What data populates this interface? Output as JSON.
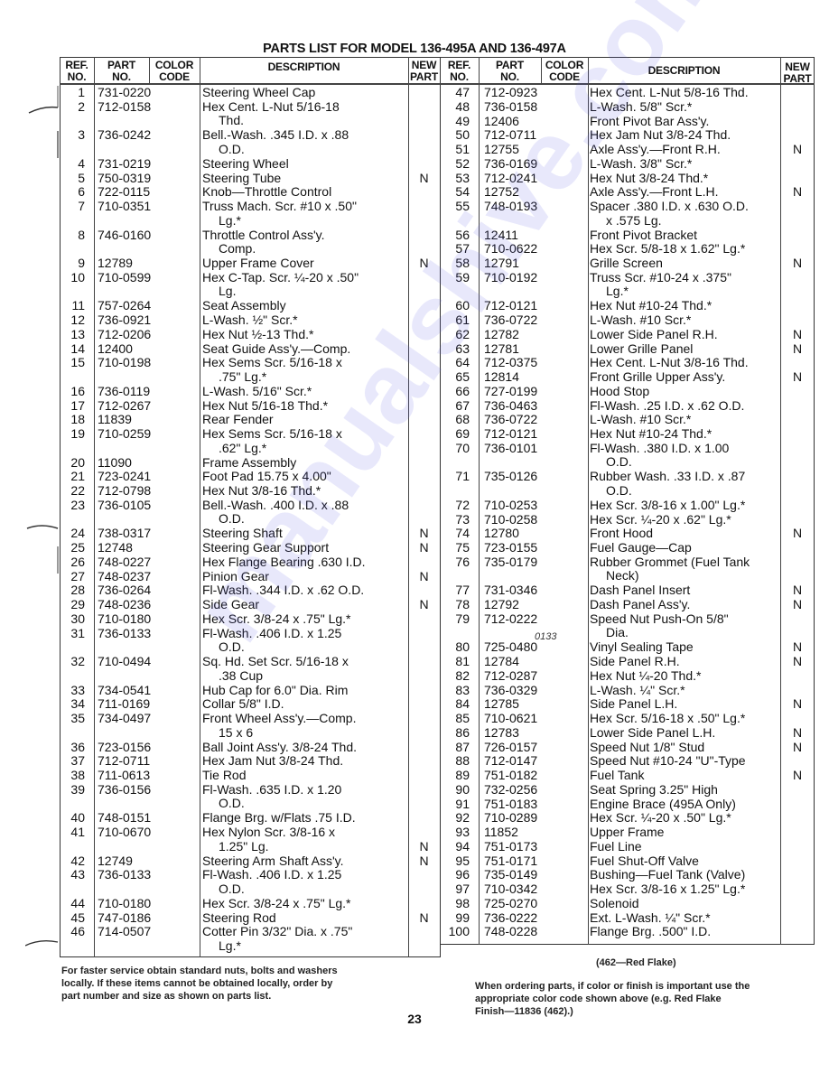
{
  "title": "PARTS LIST FOR MODEL 136-495A AND 136-497A",
  "headers": {
    "ref": [
      "REF.",
      "NO."
    ],
    "part": [
      "PART",
      "NO."
    ],
    "color": [
      "COLOR",
      "CODE"
    ],
    "description": "DESCRIPTION",
    "new": [
      "NEW",
      "PART"
    ]
  },
  "left_rows": [
    {
      "ref": "1",
      "part": "731-0220",
      "desc": [
        "Steering Wheel Cap"
      ],
      "new": ""
    },
    {
      "ref": "2",
      "part": "712-0158",
      "desc": [
        "Hex Cent. L-Nut 5/16-18",
        "Thd."
      ],
      "new": ""
    },
    {
      "ref": "3",
      "part": "736-0242",
      "desc": [
        "Bell.-Wash. .345 I.D. x .88",
        "O.D."
      ],
      "new": ""
    },
    {
      "ref": "4",
      "part": "731-0219",
      "desc": [
        "Steering Wheel"
      ],
      "new": ""
    },
    {
      "ref": "5",
      "part": "750-0319",
      "desc": [
        "Steering Tube"
      ],
      "new": "N"
    },
    {
      "ref": "6",
      "part": "722-0115",
      "desc": [
        "Knob—Throttle Control"
      ],
      "new": ""
    },
    {
      "ref": "7",
      "part": "710-0351",
      "desc": [
        "Truss Mach. Scr. #10 x .50\"",
        "Lg.*"
      ],
      "new": ""
    },
    {
      "ref": "8",
      "part": "746-0160",
      "desc": [
        "Throttle Control Ass'y.",
        "Comp."
      ],
      "new": ""
    },
    {
      "ref": "9",
      "part": "12789",
      "desc": [
        "Upper Frame Cover"
      ],
      "new": "N"
    },
    {
      "ref": "10",
      "part": "710-0599",
      "desc": [
        "Hex C-Tap. Scr. ¼-20 x .50\"",
        "Lg."
      ],
      "new": ""
    },
    {
      "ref": "11",
      "part": "757-0264",
      "desc": [
        "Seat Assembly"
      ],
      "new": ""
    },
    {
      "ref": "12",
      "part": "736-0921",
      "desc": [
        "L-Wash. ½\" Scr.*"
      ],
      "new": ""
    },
    {
      "ref": "13",
      "part": "712-0206",
      "desc": [
        "Hex Nut ½-13 Thd.*"
      ],
      "new": ""
    },
    {
      "ref": "14",
      "part": "12400",
      "desc": [
        "Seat Guide Ass'y.—Comp."
      ],
      "new": ""
    },
    {
      "ref": "15",
      "part": "710-0198",
      "desc": [
        "Hex Sems Scr. 5/16-18 x",
        ".75\" Lg.*"
      ],
      "new": ""
    },
    {
      "ref": "16",
      "part": "736-0119",
      "desc": [
        "L-Wash. 5/16\" Scr.*"
      ],
      "new": ""
    },
    {
      "ref": "17",
      "part": "712-0267",
      "desc": [
        "Hex Nut 5/16-18 Thd.*"
      ],
      "new": ""
    },
    {
      "ref": "18",
      "part": "11839",
      "desc": [
        "Rear Fender"
      ],
      "new": ""
    },
    {
      "ref": "19",
      "part": "710-0259",
      "desc": [
        "Hex Sems Scr. 5/16-18 x",
        ".62\" Lg.*"
      ],
      "new": ""
    },
    {
      "ref": "20",
      "part": "11090",
      "desc": [
        "Frame Assembly"
      ],
      "new": ""
    },
    {
      "ref": "21",
      "part": "723-0241",
      "desc": [
        "Foot Pad 15.75 x 4.00\""
      ],
      "new": ""
    },
    {
      "ref": "22",
      "part": "712-0798",
      "desc": [
        "Hex Nut 3/8-16 Thd.*"
      ],
      "new": ""
    },
    {
      "ref": "23",
      "part": "736-0105",
      "desc": [
        "Bell.-Wash. .400 I.D. x .88",
        "O.D."
      ],
      "new": ""
    },
    {
      "ref": "24",
      "part": "738-0317",
      "desc": [
        "Steering Shaft"
      ],
      "new": "N"
    },
    {
      "ref": "25",
      "part": "12748",
      "desc": [
        "Steering Gear Support"
      ],
      "new": "N"
    },
    {
      "ref": "26",
      "part": "748-0227",
      "desc": [
        "Hex Flange Bearing .630 I.D."
      ],
      "new": ""
    },
    {
      "ref": "27",
      "part": "748-0237",
      "desc": [
        "Pinion Gear"
      ],
      "new": "N"
    },
    {
      "ref": "28",
      "part": "736-0264",
      "desc": [
        "Fl-Wash. .344 I.D. x .62 O.D."
      ],
      "new": ""
    },
    {
      "ref": "29",
      "part": "748-0236",
      "desc": [
        "Side Gear"
      ],
      "new": "N"
    },
    {
      "ref": "30",
      "part": "710-0180",
      "desc": [
        "Hex Scr. 3/8-24 x .75\" Lg.*"
      ],
      "new": ""
    },
    {
      "ref": "31",
      "part": "736-0133",
      "desc": [
        "Fl-Wash. .406 I.D. x 1.25",
        "O.D."
      ],
      "new": ""
    },
    {
      "ref": "32",
      "part": "710-0494",
      "desc": [
        "Sq. Hd. Set Scr. 5/16-18 x",
        ".38 Cup"
      ],
      "new": ""
    },
    {
      "ref": "33",
      "part": "734-0541",
      "desc": [
        "Hub Cap for 6.0\" Dia. Rim"
      ],
      "new": ""
    },
    {
      "ref": "34",
      "part": "711-0169",
      "desc": [
        "Collar 5/8\" I.D."
      ],
      "new": ""
    },
    {
      "ref": "35",
      "part": "734-0497",
      "desc": [
        "Front Wheel Ass'y.—Comp.",
        "15 x 6"
      ],
      "new": ""
    },
    {
      "ref": "36",
      "part": "723-0156",
      "desc": [
        "Ball Joint Ass'y. 3/8-24 Thd."
      ],
      "new": ""
    },
    {
      "ref": "37",
      "part": "712-0711",
      "desc": [
        "Hex Jam Nut 3/8-24 Thd."
      ],
      "new": ""
    },
    {
      "ref": "38",
      "part": "711-0613",
      "desc": [
        "Tie Rod"
      ],
      "new": ""
    },
    {
      "ref": "39",
      "part": "736-0156",
      "desc": [
        "Fl-Wash. .635 I.D. x 1.20",
        "O.D."
      ],
      "new": ""
    },
    {
      "ref": "40",
      "part": "748-0151",
      "desc": [
        "Flange Brg. w/Flats .75 I.D."
      ],
      "new": ""
    },
    {
      "ref": "41",
      "part": "710-0670",
      "desc": [
        "Hex Nylon Scr. 3/8-16 x",
        "1.25\" Lg."
      ],
      "new": "",
      "new2": "N"
    },
    {
      "ref": "42",
      "part": "12749",
      "desc": [
        "Steering Arm Shaft Ass'y."
      ],
      "new": "N"
    },
    {
      "ref": "43",
      "part": "736-0133",
      "desc": [
        "Fl-Wash. .406 I.D. x 1.25",
        "O.D."
      ],
      "new": ""
    },
    {
      "ref": "44",
      "part": "710-0180",
      "desc": [
        "Hex Scr. 3/8-24 x .75\" Lg.*"
      ],
      "new": ""
    },
    {
      "ref": "45",
      "part": "747-0186",
      "desc": [
        "Steering Rod"
      ],
      "new": "N"
    },
    {
      "ref": "46",
      "part": "714-0507",
      "desc": [
        "Cotter Pin 3/32\" Dia. x .75\"",
        "Lg.*"
      ],
      "new": ""
    }
  ],
  "right_rows": [
    {
      "ref": "47",
      "part": "712-0923",
      "desc": [
        "Hex Cent. L-Nut 5/8-16 Thd."
      ],
      "new": ""
    },
    {
      "ref": "48",
      "part": "736-0158",
      "desc": [
        "L-Wash. 5/8\" Scr.*"
      ],
      "new": ""
    },
    {
      "ref": "49",
      "part": "12406",
      "desc": [
        "Front Pivot Bar Ass'y."
      ],
      "new": ""
    },
    {
      "ref": "50",
      "part": "712-0711",
      "desc": [
        "Hex Jam Nut 3/8-24 Thd."
      ],
      "new": ""
    },
    {
      "ref": "51",
      "part": "12755",
      "desc": [
        "Axle Ass'y.—Front R.H."
      ],
      "new": "N"
    },
    {
      "ref": "52",
      "part": "736-0169",
      "desc": [
        "L-Wash. 3/8\" Scr.*"
      ],
      "new": ""
    },
    {
      "ref": "53",
      "part": "712-0241",
      "desc": [
        "Hex Nut 3/8-24 Thd.*"
      ],
      "new": ""
    },
    {
      "ref": "54",
      "part": "12752",
      "desc": [
        "Axle Ass'y.—Front L.H."
      ],
      "new": "N"
    },
    {
      "ref": "55",
      "part": "748-0193",
      "desc": [
        "Spacer .380 I.D. x .630 O.D.",
        "x .575 Lg."
      ],
      "new": ""
    },
    {
      "ref": "56",
      "part": "12411",
      "desc": [
        "Front Pivot Bracket"
      ],
      "new": ""
    },
    {
      "ref": "57",
      "part": "710-0622",
      "desc": [
        "Hex Scr. 5/8-18 x 1.62\" Lg.*"
      ],
      "new": ""
    },
    {
      "ref": "58",
      "part": "12791",
      "desc": [
        "Grille Screen"
      ],
      "new": "N"
    },
    {
      "ref": "59",
      "part": "710-0192",
      "desc": [
        "Truss Scr. #10-24 x .375\"",
        "Lg.*"
      ],
      "new": ""
    },
    {
      "ref": "60",
      "part": "712-0121",
      "desc": [
        "Hex Nut #10-24 Thd.*"
      ],
      "new": ""
    },
    {
      "ref": "61",
      "part": "736-0722",
      "desc": [
        "L-Wash. #10 Scr.*"
      ],
      "new": ""
    },
    {
      "ref": "62",
      "part": "12782",
      "desc": [
        "Lower Side Panel R.H."
      ],
      "new": "N"
    },
    {
      "ref": "63",
      "part": "12781",
      "desc": [
        "Lower Grille Panel"
      ],
      "new": "N"
    },
    {
      "ref": "64",
      "part": "712-0375",
      "desc": [
        "Hex Cent. L-Nut 3/8-16 Thd."
      ],
      "new": ""
    },
    {
      "ref": "65",
      "part": "12814",
      "desc": [
        "Front Grille Upper Ass'y."
      ],
      "new": "N"
    },
    {
      "ref": "66",
      "part": "727-0199",
      "desc": [
        "Hood Stop"
      ],
      "new": ""
    },
    {
      "ref": "67",
      "part": "736-0463",
      "desc": [
        "Fl-Wash. .25 I.D. x .62 O.D."
      ],
      "new": ""
    },
    {
      "ref": "68",
      "part": "736-0722",
      "desc": [
        "L-Wash. #10 Scr.*"
      ],
      "new": ""
    },
    {
      "ref": "69",
      "part": "712-0121",
      "desc": [
        "Hex Nut #10-24 Thd.*"
      ],
      "new": ""
    },
    {
      "ref": "70",
      "part": "736-0101",
      "desc": [
        "Fl-Wash. .380 I.D. x 1.00",
        "O.D."
      ],
      "new": ""
    },
    {
      "ref": "71",
      "part": "735-0126",
      "desc": [
        "Rubber Wash. .33 I.D. x .87",
        "O.D."
      ],
      "new": ""
    },
    {
      "ref": "72",
      "part": "710-0253",
      "desc": [
        "Hex Scr. 3/8-16 x 1.00\" Lg.*"
      ],
      "new": ""
    },
    {
      "ref": "73",
      "part": "710-0258",
      "desc": [
        "Hex Scr. ¼-20 x .62\" Lg.*"
      ],
      "new": ""
    },
    {
      "ref": "74",
      "part": "12780",
      "desc": [
        "Front Hood"
      ],
      "new": "N"
    },
    {
      "ref": "75",
      "part": "723-0155",
      "desc": [
        "Fuel Gauge—Cap"
      ],
      "new": ""
    },
    {
      "ref": "76",
      "part": "735-0179",
      "desc": [
        "Rubber Grommet (Fuel Tank",
        "Neck)"
      ],
      "new": ""
    },
    {
      "ref": "77",
      "part": "731-0346",
      "desc": [
        "Dash Panel Insert"
      ],
      "new": "N"
    },
    {
      "ref": "78",
      "part": "12792",
      "desc": [
        "Dash Panel Ass'y."
      ],
      "new": "N"
    },
    {
      "ref": "79",
      "part": "712-0222",
      "desc": [
        "Speed Nut Push-On 5/8\"",
        "Dia."
      ],
      "new": ""
    },
    {
      "ref": "80",
      "part": "725-0480",
      "part_handwritten_correction": "0133",
      "desc": [
        "Vinyl Sealing Tape"
      ],
      "new": "N"
    },
    {
      "ref": "81",
      "part": "12784",
      "desc": [
        "Side Panel R.H."
      ],
      "new": "N"
    },
    {
      "ref": "82",
      "part": "712-0287",
      "desc": [
        "Hex Nut ¼-20 Thd.*"
      ],
      "new": ""
    },
    {
      "ref": "83",
      "part": "736-0329",
      "desc": [
        "L-Wash. ¼\" Scr.*"
      ],
      "new": ""
    },
    {
      "ref": "84",
      "part": "12785",
      "desc": [
        "Side Panel L.H."
      ],
      "new": "N"
    },
    {
      "ref": "85",
      "part": "710-0621",
      "desc": [
        "Hex Scr. 5/16-18 x .50\" Lg.*"
      ],
      "new": ""
    },
    {
      "ref": "86",
      "part": "12783",
      "desc": [
        "Lower Side Panel L.H."
      ],
      "new": "N"
    },
    {
      "ref": "87",
      "part": "726-0157",
      "desc": [
        "Speed Nut 1/8\" Stud"
      ],
      "new": "N"
    },
    {
      "ref": "88",
      "part": "712-0147",
      "desc": [
        "Speed Nut #10-24 \"U\"-Type"
      ],
      "new": ""
    },
    {
      "ref": "89",
      "part": "751-0182",
      "desc": [
        "Fuel Tank"
      ],
      "new": "N"
    },
    {
      "ref": "90",
      "part": "732-0256",
      "desc": [
        "Seat Spring 3.25\" High"
      ],
      "new": ""
    },
    {
      "ref": "91",
      "part": "751-0183",
      "desc": [
        "Engine Brace (495A Only)"
      ],
      "new": ""
    },
    {
      "ref": "92",
      "part": "710-0289",
      "desc": [
        "Hex Scr. ¼-20 x .50\" Lg.*"
      ],
      "new": ""
    },
    {
      "ref": "93",
      "part": "11852",
      "desc": [
        "Upper Frame"
      ],
      "new": ""
    },
    {
      "ref": "94",
      "part": "751-0173",
      "desc": [
        "Fuel Line"
      ],
      "new": ""
    },
    {
      "ref": "95",
      "part": "751-0171",
      "desc": [
        "Fuel Shut-Off Valve"
      ],
      "new": ""
    },
    {
      "ref": "96",
      "part": "735-0149",
      "desc": [
        "Bushing—Fuel Tank (Valve)"
      ],
      "new": ""
    },
    {
      "ref": "97",
      "part": "710-0342",
      "desc": [
        "Hex Scr. 3/8-16 x 1.25\" Lg.*"
      ],
      "new": ""
    },
    {
      "ref": "98",
      "part": "725-0270",
      "desc": [
        "Solenoid"
      ],
      "new": ""
    },
    {
      "ref": "99",
      "part": "736-0222",
      "desc": [
        "Ext. L-Wash. ¼\" Scr.*"
      ],
      "new": ""
    },
    {
      "ref": "100",
      "part": "748-0228",
      "desc": [
        "Flange Brg. .500\" I.D."
      ],
      "new": ""
    }
  ],
  "footer": {
    "left_note": [
      "For faster service obtain standard nuts, bolts and washers",
      "locally. If these items cannot be obtained locally, order by",
      "part number and size as shown on parts list."
    ],
    "color_code_note": "(462—Red Flake)",
    "right_note": [
      "When ordering parts, if color or finish is important use the",
      "appropriate color code shown above (e.g. Red Flake",
      "Finish—11836 (462).)"
    ],
    "page_number": "23"
  },
  "watermark": "manualshive.com"
}
